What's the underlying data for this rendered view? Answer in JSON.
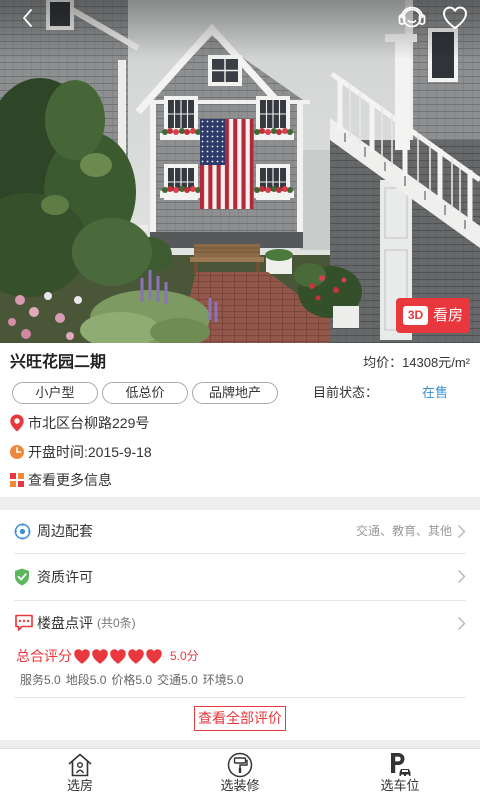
{
  "hero": {
    "back_icon": "back-arrow-icon",
    "service_icon": "headset-icon",
    "favorite_icon": "heart-outline-icon",
    "vr_badge": "3D",
    "vr_label": "看房"
  },
  "project": {
    "name": "兴旺花园二期",
    "price": "均价：14308元/m²",
    "tags": [
      "小户型",
      "低总价",
      "品牌地产"
    ],
    "status_label": "目前状态：",
    "status_value": "在售"
  },
  "info": {
    "address": "市北区台柳路229号",
    "open_date": "开盘时间:2015-9-18",
    "more_info": "查看更多信息"
  },
  "sections": {
    "surroundings": {
      "label": "周边配套",
      "detail": "交通、教育、其他",
      "icon": "location-ring-icon"
    },
    "qualification": {
      "label": "资质许可",
      "icon": "shield-check-icon"
    },
    "reviews": {
      "label": "楼盘点评",
      "count": "(共0条)",
      "icon": "chat-bubble-icon"
    }
  },
  "rating": {
    "label": "总合评分",
    "hearts": 5,
    "score": "5.0分",
    "details": [
      "服务5.0",
      "地段5.0",
      "价格5.0",
      "交通5.0",
      "环境5.0"
    ],
    "view_all": "查看全部评价"
  },
  "tabbar": [
    {
      "label": "选房",
      "icon": "house-icon"
    },
    {
      "label": "选装修",
      "icon": "paint-roller-icon"
    },
    {
      "label": "选车位",
      "icon": "parking-icon"
    }
  ],
  "colors": {
    "accent": "#e8383d",
    "status_blue": "#3a8fd6",
    "green": "#5cb85c",
    "orange": "#f0873a",
    "text": "#333333",
    "muted": "#999999"
  }
}
